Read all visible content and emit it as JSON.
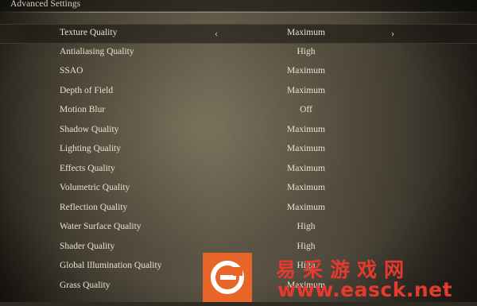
{
  "header": {
    "title": "Advanced Settings"
  },
  "settings": [
    {
      "label": "Texture Quality",
      "value": "Maximum",
      "selected": true
    },
    {
      "label": "Antialiasing Quality",
      "value": "High"
    },
    {
      "label": "SSAO",
      "value": "Maximum"
    },
    {
      "label": "Depth of Field",
      "value": "Maximum"
    },
    {
      "label": "Motion Blur",
      "value": "Off"
    },
    {
      "label": "Shadow Quality",
      "value": "Maximum"
    },
    {
      "label": "Lighting Quality",
      "value": "Maximum"
    },
    {
      "label": "Effects Quality",
      "value": "Maximum"
    },
    {
      "label": "Volumetric Quality",
      "value": "Maximum"
    },
    {
      "label": "Reflection Quality",
      "value": "Maximum"
    },
    {
      "label": "Water Surface Quality",
      "value": "High"
    },
    {
      "label": "Shader Quality",
      "value": "High"
    },
    {
      "label": "Global Illumination Quality",
      "value": "High"
    },
    {
      "label": "Grass Quality",
      "value": "Maximum"
    }
  ],
  "icons": {
    "prev": "chevron-left-icon",
    "next": "chevron-right-icon"
  },
  "watermark": {
    "cn_text": "易采游戏网",
    "url_text": "www.easck.net",
    "logo_color": "#e8652a",
    "text_color": "#e63a2e"
  }
}
